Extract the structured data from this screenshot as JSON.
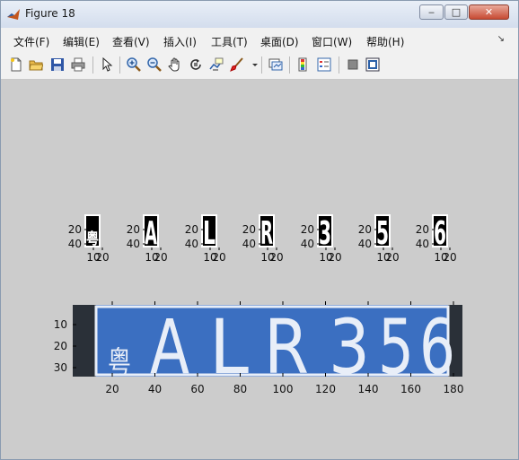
{
  "window": {
    "title": "Figure 18",
    "minimize": "‒",
    "maximize": "□",
    "close": "✕"
  },
  "menu": {
    "items": [
      "文件(F)",
      "编辑(E)",
      "查看(V)",
      "插入(I)",
      "工具(T)",
      "桌面(D)",
      "窗口(W)",
      "帮助(H)"
    ],
    "overflow_arrow": "↘"
  },
  "toolbar": {
    "icons": [
      "new-figure-icon",
      "open-file-icon",
      "save-icon",
      "print-icon",
      "pointer-icon",
      "zoom-in-icon",
      "zoom-out-icon",
      "pan-hand-icon",
      "rotate-3d-icon",
      "data-cursor-icon",
      "brush-icon",
      "brush-dropdown-icon",
      "link-plot-icon",
      "colorbar-icon",
      "legend-icon",
      "hide-plot-tools-icon",
      "show-plot-tools-icon"
    ]
  },
  "figure": {
    "characters": [
      {
        "glyph": "粤",
        "ytick_labels": [
          "20",
          "40"
        ],
        "xtick_labels": [
          "10",
          "20"
        ]
      },
      {
        "glyph": "A",
        "ytick_labels": [
          "20",
          "40"
        ],
        "xtick_labels": [
          "10",
          "20"
        ]
      },
      {
        "glyph": "L",
        "ytick_labels": [
          "20",
          "40"
        ],
        "xtick_labels": [
          "10",
          "20"
        ]
      },
      {
        "glyph": "R",
        "ytick_labels": [
          "20",
          "40"
        ],
        "xtick_labels": [
          "10",
          "20"
        ]
      },
      {
        "glyph": "3",
        "ytick_labels": [
          "20",
          "40"
        ],
        "xtick_labels": [
          "10",
          "20"
        ]
      },
      {
        "glyph": "5",
        "ytick_labels": [
          "20",
          "40"
        ],
        "xtick_labels": [
          "10",
          "20"
        ]
      },
      {
        "glyph": "6",
        "ytick_labels": [
          "20",
          "40"
        ],
        "xtick_labels": [
          "10",
          "20"
        ]
      }
    ],
    "plate": {
      "text_chars": [
        "粤",
        "A",
        "L",
        "R",
        "3",
        "5",
        "6"
      ],
      "y_ticks": [
        "10",
        "20",
        "30"
      ],
      "x_ticks": [
        "20",
        "40",
        "60",
        "80",
        "100",
        "120",
        "140",
        "160",
        "180"
      ],
      "colors": {
        "plate_blue": "#3b6fc1",
        "dark_edge": "#2a3038",
        "char_white": "#e8eef8"
      }
    }
  }
}
